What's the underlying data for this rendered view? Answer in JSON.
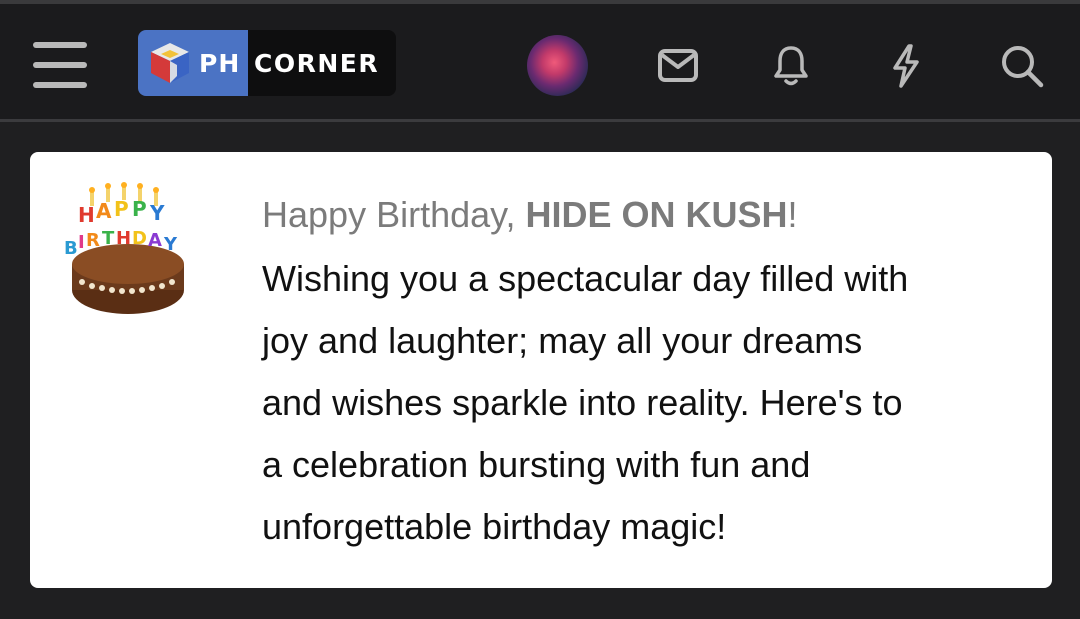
{
  "header": {
    "logo": {
      "left_text": "PH",
      "right_text": "CORNER"
    },
    "icons": [
      "menu-icon",
      "avatar",
      "mail-icon",
      "bell-icon",
      "lightning-icon",
      "search-icon"
    ]
  },
  "card": {
    "image": {
      "name": "birthday-cake",
      "text": "HAPPY BIRTHDAY"
    },
    "greeting_prefix": "Happy Birthday, ",
    "username": "HIDE ON KUSH",
    "greeting_suffix": "!",
    "lines": [
      "Wishing you a spectacular day filled with",
      "joy and laughter; may all your dreams",
      "and wishes sparkle into reality. Here's to",
      "a celebration bursting with fun and",
      "unforgettable birthday magic!"
    ]
  },
  "colors": {
    "background": "#1f1f21",
    "header": "#1b1b1d",
    "card": "#ffffff",
    "logo_blue": "#4b73c4",
    "greeting_gray": "#7b7b7b",
    "text": "#111111",
    "icon": "#b9b9b9"
  }
}
